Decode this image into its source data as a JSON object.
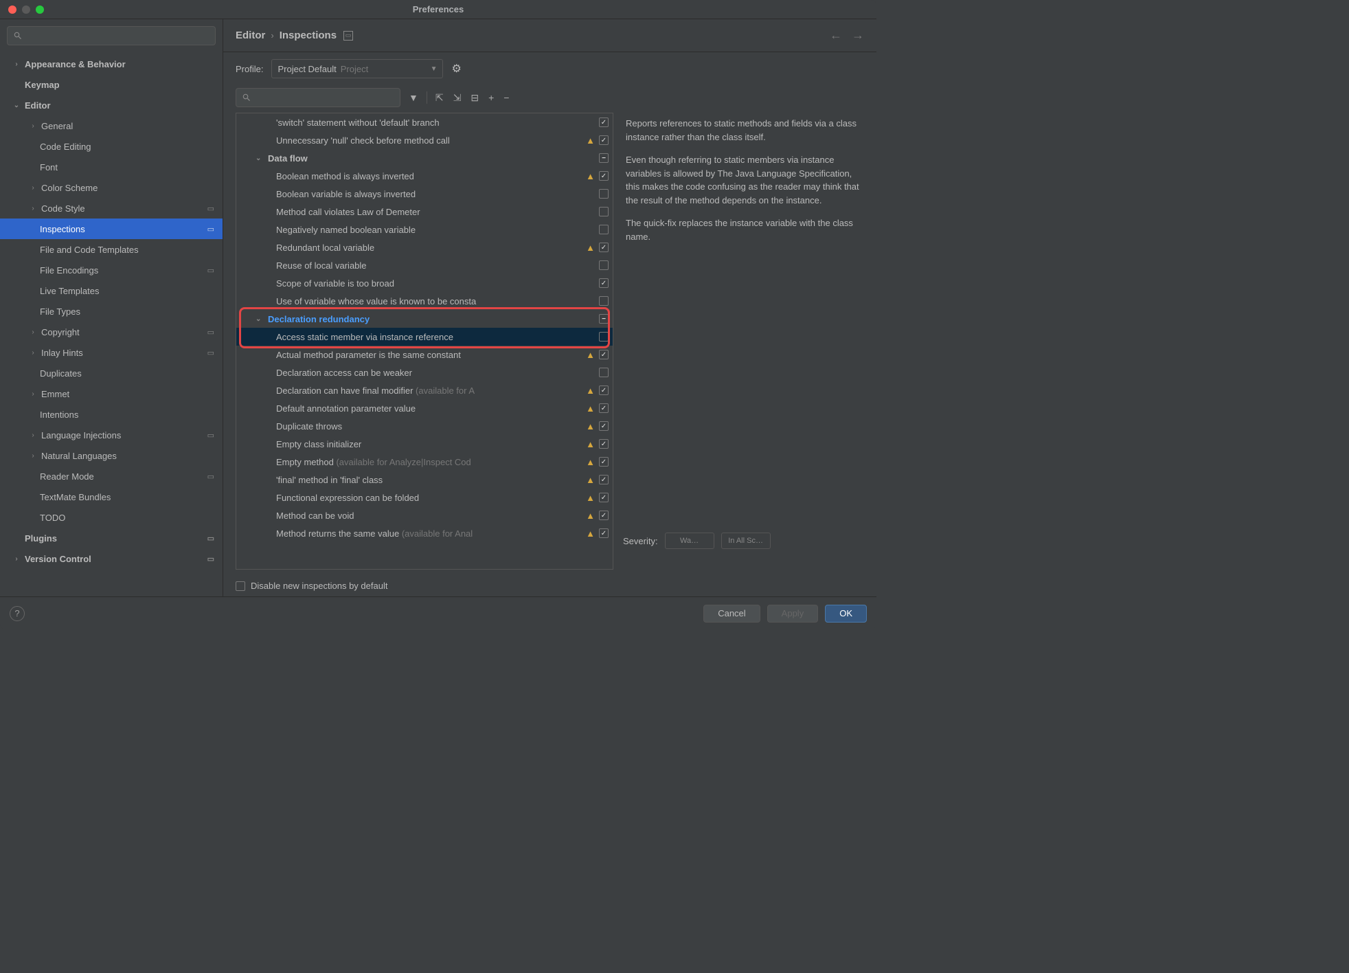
{
  "window": {
    "title": "Preferences"
  },
  "breadcrumb": {
    "parent": "Editor",
    "current": "Inspections"
  },
  "profile": {
    "label": "Profile:",
    "value": "Project Default",
    "scope": "Project"
  },
  "sidebar": {
    "items": [
      {
        "label": "Appearance & Behavior",
        "chev": "›",
        "bold": true
      },
      {
        "label": "Keymap",
        "bold": true
      },
      {
        "label": "Editor",
        "chev": "⌄",
        "bold": true
      },
      {
        "label": "General",
        "chev": "›",
        "sub": true
      },
      {
        "label": "Code Editing",
        "sub2": true
      },
      {
        "label": "Font",
        "sub2": true
      },
      {
        "label": "Color Scheme",
        "chev": "›",
        "sub": true
      },
      {
        "label": "Code Style",
        "chev": "›",
        "sub": true,
        "badge": "▭"
      },
      {
        "label": "Inspections",
        "sub2": true,
        "selected": true,
        "badge": "▭"
      },
      {
        "label": "File and Code Templates",
        "sub2": true
      },
      {
        "label": "File Encodings",
        "sub2": true,
        "badge": "▭"
      },
      {
        "label": "Live Templates",
        "sub2": true
      },
      {
        "label": "File Types",
        "sub2": true
      },
      {
        "label": "Copyright",
        "chev": "›",
        "sub": true,
        "badge": "▭"
      },
      {
        "label": "Inlay Hints",
        "chev": "›",
        "sub": true,
        "badge": "▭"
      },
      {
        "label": "Duplicates",
        "sub2": true
      },
      {
        "label": "Emmet",
        "chev": "›",
        "sub": true
      },
      {
        "label": "Intentions",
        "sub2": true
      },
      {
        "label": "Language Injections",
        "chev": "›",
        "sub": true,
        "badge": "▭"
      },
      {
        "label": "Natural Languages",
        "chev": "›",
        "sub": true
      },
      {
        "label": "Reader Mode",
        "sub2": true,
        "badge": "▭"
      },
      {
        "label": "TextMate Bundles",
        "sub2": true
      },
      {
        "label": "TODO",
        "sub2": true
      },
      {
        "label": "Plugins",
        "bold": true,
        "badge": "▭"
      },
      {
        "label": "Version Control",
        "chev": "›",
        "bold": true,
        "badge": "▭"
      }
    ]
  },
  "inspections": [
    {
      "label": "'switch' statement without 'default' branch",
      "warn": false,
      "checked": true
    },
    {
      "label": "Unnecessary 'null' check before method call",
      "warn": true,
      "checked": true
    },
    {
      "group": true,
      "label": "Data flow",
      "mixed": true
    },
    {
      "label": "Boolean method is always inverted",
      "warn": true,
      "checked": true
    },
    {
      "label": "Boolean variable is always inverted",
      "checked": false
    },
    {
      "label": "Method call violates Law of Demeter",
      "checked": false
    },
    {
      "label": "Negatively named boolean variable",
      "checked": false
    },
    {
      "label": "Redundant local variable",
      "warn": true,
      "checked": true
    },
    {
      "label": "Reuse of local variable",
      "checked": false
    },
    {
      "label": "Scope of variable is too broad",
      "checked": true
    },
    {
      "label": "Use of variable whose value is known to be consta",
      "checked": false
    },
    {
      "group": true,
      "label": "Declaration redundancy",
      "mixed": true,
      "highlighted": true
    },
    {
      "label": "Access static member via instance reference",
      "checked": false,
      "selected": true
    },
    {
      "label": "Actual method parameter is the same constant",
      "warn": true,
      "checked": true
    },
    {
      "label": "Declaration access can be weaker",
      "checked": false
    },
    {
      "label": "Declaration can have final modifier",
      "dim": " (available for A",
      "warn": true,
      "checked": true
    },
    {
      "label": "Default annotation parameter value",
      "warn": true,
      "checked": true
    },
    {
      "label": "Duplicate throws",
      "warn": true,
      "checked": true
    },
    {
      "label": "Empty class initializer",
      "warn": true,
      "checked": true
    },
    {
      "label": "Empty method",
      "dim": " (available for Analyze|Inspect Cod",
      "warn": true,
      "checked": true
    },
    {
      "label": "'final' method in 'final' class",
      "warn": true,
      "checked": true
    },
    {
      "label": "Functional expression can be folded",
      "warn": true,
      "checked": true
    },
    {
      "label": "Method can be void",
      "warn": true,
      "checked": true
    },
    {
      "label": "Method returns the same value",
      "dim": " (available for Anal",
      "warn": true,
      "checked": true
    }
  ],
  "description": {
    "p1": "Reports references to static methods and fields via a class instance rather than the class itself.",
    "p2": "Even though referring to static members via instance variables is allowed by The Java Language Specification, this makes the code confusing as the reader may think that the result of the method depends on the instance.",
    "p3": "The quick-fix replaces the instance variable with the class name."
  },
  "severity": {
    "label": "Severity:",
    "value": "Wa…",
    "scope": "In All Sc…"
  },
  "disable_row": {
    "label": "Disable new inspections by default"
  },
  "footer": {
    "cancel": "Cancel",
    "apply": "Apply",
    "ok": "OK"
  }
}
